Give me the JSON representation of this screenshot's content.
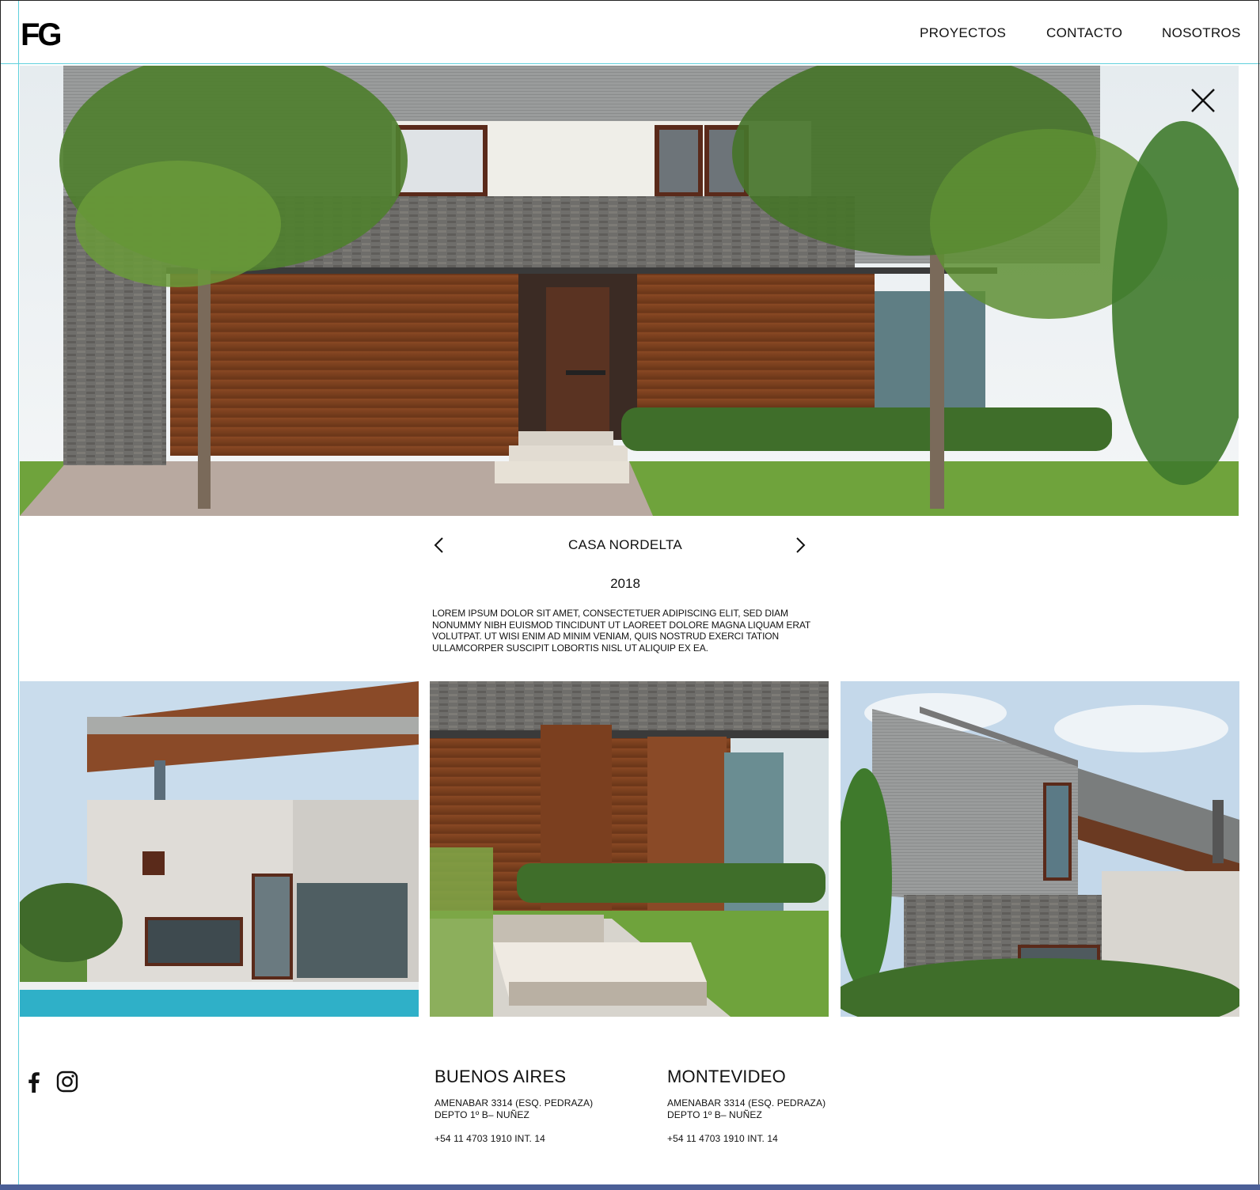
{
  "header": {
    "logo": "FG",
    "nav": [
      "PROYECTOS",
      "CONTACTO",
      "NOSOTROS"
    ]
  },
  "project": {
    "title": "CASA NORDELTA",
    "year": "2018",
    "description": "LOREM IPSUM DOLOR SIT AMET, CONSECTETUER ADIPISCING ELIT, SED  DIAM NONUMMY NIBH EUISMOD TINCIDUNT UT LAOREET DOLORE MAGNA  LIQUAM ERAT VOLUTPAT. UT WISI ENIM AD MINIM VENIAM, QUIS NOSTRUD  EXERCI TATION ULLAMCORPER SUSCIPIT LOBORTIS NISL UT ALIQUIP EX EA."
  },
  "icons": {
    "close": "close-icon",
    "prev": "chevron-left-icon",
    "next": "chevron-right-icon",
    "facebook": "facebook-icon",
    "instagram": "instagram-icon"
  },
  "footer": {
    "offices": [
      {
        "city": "BUENOS AIRES",
        "address_line1": "AMENABAR 3314 (ESQ. PEDRAZA)",
        "address_line2": "DEPTO 1º B– NUÑEZ",
        "phone": "+54 11 4703 1910 INT. 14"
      },
      {
        "city": "MONTEVIDEO",
        "address_line1": "AMENABAR 3314 (ESQ. PEDRAZA)",
        "address_line2": "DEPTO 1º B– NUÑEZ",
        "phone": "+54 11 4703 1910 INT. 14"
      }
    ]
  },
  "colors": {
    "guide": "#5fd0dc",
    "bottom_bar": "#4b5f97",
    "text": "#111111"
  }
}
